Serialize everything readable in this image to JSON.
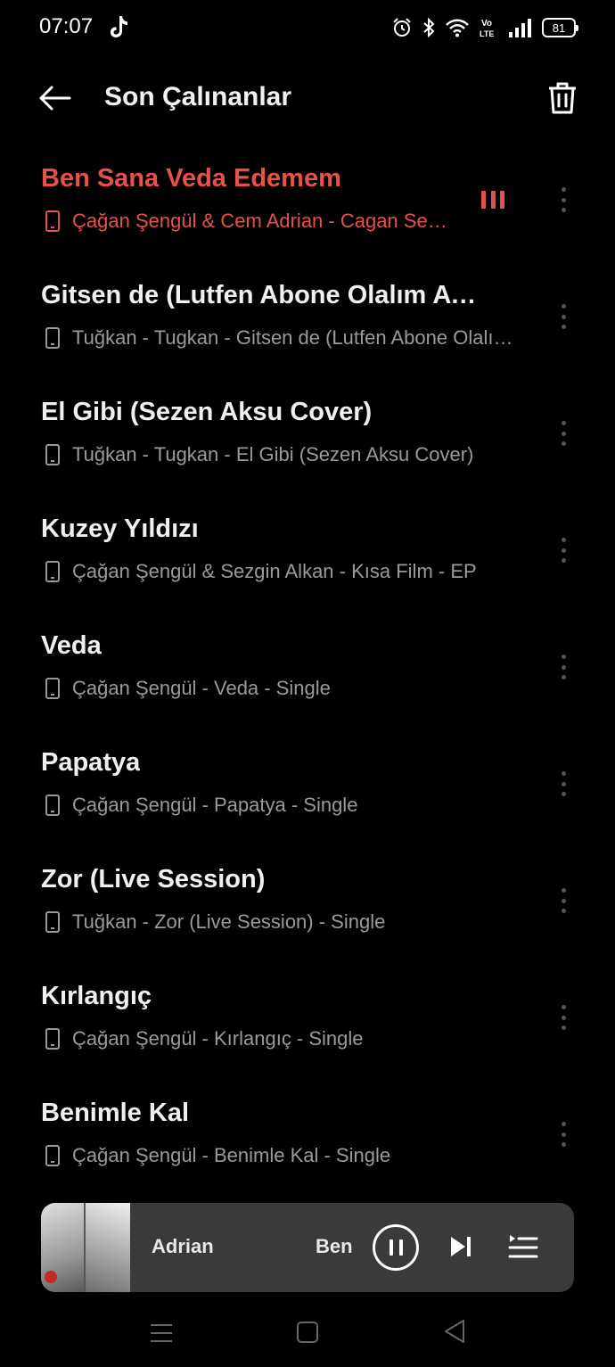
{
  "status_bar": {
    "time": "07:07",
    "notification_icon": "tiktok-icon",
    "icons": [
      "alarm-icon",
      "bluetooth-icon",
      "wifi-icon",
      "volte-icon",
      "signal-icon",
      "battery-icon"
    ],
    "volte_label_top": "Vo",
    "volte_label_bottom": "LTE",
    "battery_level": "81"
  },
  "header": {
    "title": "Son Çalınanlar",
    "back_icon": "arrow-left-icon",
    "delete_icon": "trash-icon"
  },
  "songs": [
    {
      "title": "Ben Sana Veda Edemem",
      "meta": "Çağan Şengül & Cem Adrian - Cagan Sengul & Cem Adrian",
      "playing": true
    },
    {
      "title": "Gitsen de (Lutfen Abone Olalım Ayrılmayalım)",
      "meta": "Tuğkan - Tugkan - Gitsen de (Lutfen Abone Olalım Ayrılmayalım)",
      "playing": false
    },
    {
      "title": "El Gibi (Sezen Aksu Cover)",
      "meta": "Tuğkan - Tugkan - El Gibi (Sezen Aksu Cover)",
      "playing": false
    },
    {
      "title": "Kuzey Yıldızı",
      "meta": "Çağan Şengül & Sezgin Alkan - Kısa Film - EP",
      "playing": false
    },
    {
      "title": "Veda",
      "meta": "Çağan Şengül - Veda - Single",
      "playing": false
    },
    {
      "title": "Papatya",
      "meta": "Çağan Şengül - Papatya - Single",
      "playing": false
    },
    {
      "title": "Zor (Live Session)",
      "meta": "Tuğkan - Zor (Live Session) - Single",
      "playing": false
    },
    {
      "title": "Kırlangıç",
      "meta": "Çağan Şengül - Kırlangıç - Single",
      "playing": false
    },
    {
      "title": "Benimle Kal",
      "meta": "Çağan Şengül - Benimle Kal - Single",
      "playing": false
    }
  ],
  "mini_player": {
    "scroll_text_a": "Adrian",
    "scroll_text_b": "Ben",
    "pause_icon": "pause-icon",
    "next_icon": "skip-next-icon",
    "queue_icon": "queue-icon"
  },
  "nav_bar": {
    "icons": [
      "menu-icon",
      "home-icon",
      "back-triangle-icon"
    ]
  },
  "colors": {
    "background": "#000000",
    "accent": "#e8504c",
    "secondary_text": "#9a9a9a",
    "player_bg": "#3a3a3c"
  }
}
